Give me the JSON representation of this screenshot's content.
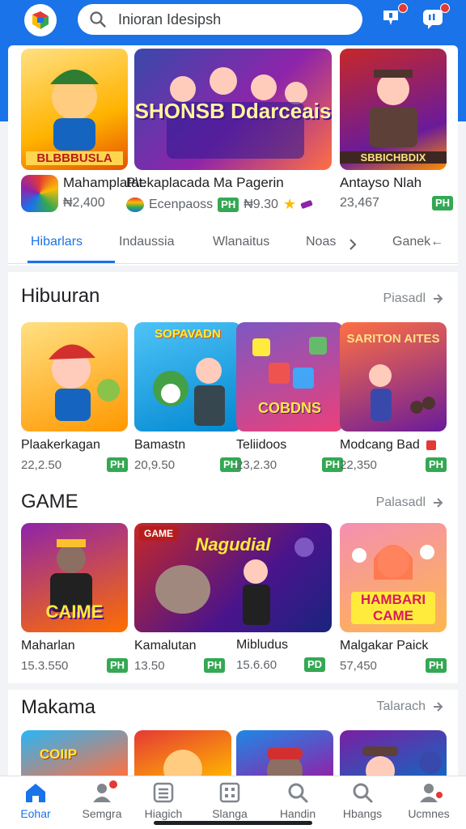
{
  "header": {
    "search_placeholder": "Inioran Idesipsh",
    "icons": [
      "app-logo",
      "search-icon",
      "notification-icon",
      "message-icon"
    ]
  },
  "featured": [
    {
      "caption": "BLBBBUSLA",
      "title": "Mahamplatat.",
      "price": "₦2,400"
    },
    {
      "caption": "SHONSB Ddarceais",
      "title": "P\\ekaplacada Ma Pagerin",
      "sub": "Ecenpaoss",
      "price": "₦9.30"
    },
    {
      "caption": "SBBICHBDIX",
      "title": "Antayso Nlah",
      "price": "23,467"
    }
  ],
  "tabs": [
    "Hibarlars",
    "Indaussia",
    "Wlanaitus",
    "Noas",
    "Ganek←"
  ],
  "badge_label": "PH",
  "badge_label_alt": "PD",
  "sections": [
    {
      "title": "Hibuuran",
      "more": "Piasadl",
      "cards": [
        {
          "caption": "",
          "name": "Plaakerkagan",
          "price": "22,2.50",
          "badge": "PH"
        },
        {
          "caption": "SOPAVADN",
          "name": "Bamastn",
          "price": "20,9.50",
          "badge": "PH"
        },
        {
          "caption": "COBDNS",
          "name": "Teliidoos",
          "price": "23,2.30",
          "badge": "PH"
        },
        {
          "caption": "SARITON AITES",
          "name": "Modcang Bad",
          "price": "22,350",
          "badge": "PH"
        }
      ]
    },
    {
      "title": "GAME",
      "more": "Palasadl",
      "cards": [
        {
          "caption": "CAIME",
          "name": "Maharlan",
          "price": "15.3.550",
          "badge": "PH"
        },
        {
          "caption": "Nagudial",
          "name": "Kamalutan",
          "price": "13.50",
          "badge": "PH"
        },
        {
          "caption": "",
          "name": "Mibludus",
          "price": "15.6.60",
          "badge": "PD"
        },
        {
          "caption": "HAMBARI CAME",
          "name": "Malgakar Paick",
          "price": "57,450",
          "badge": "PH"
        }
      ]
    },
    {
      "title": "Makama",
      "more": "Talarach",
      "cards": [
        {
          "caption": "COIIP"
        },
        {
          "caption": ""
        },
        {
          "caption": ""
        },
        {
          "caption": ""
        }
      ]
    }
  ],
  "nav": [
    {
      "label": "Eohar",
      "icon": "home-icon"
    },
    {
      "label": "Semgra",
      "icon": "person-icon"
    },
    {
      "label": "Hiagich",
      "icon": "list-icon"
    },
    {
      "label": "Slanga",
      "icon": "grid-icon"
    },
    {
      "label": "Handin",
      "icon": "search-icon"
    },
    {
      "label": "Hbangs",
      "icon": "search-icon"
    },
    {
      "label": "Ucmnes",
      "icon": "user-icon"
    }
  ],
  "colors": {
    "accent": "#1a73e8",
    "badge": "#34a853",
    "notif": "#e53935"
  }
}
